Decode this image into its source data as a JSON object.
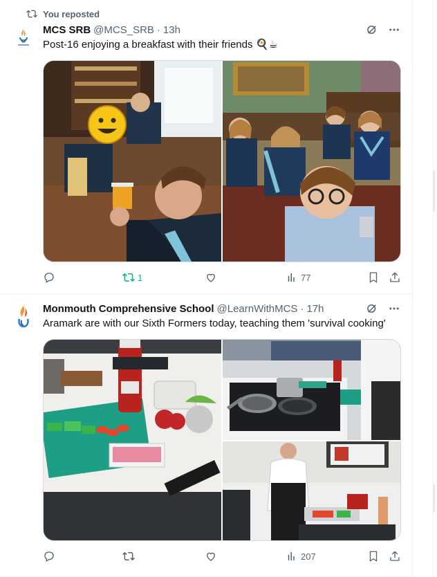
{
  "colors": {
    "muted": "#536471",
    "text": "#0f1419",
    "repost_green": "#00ba7c",
    "border": "#eff3f4"
  },
  "tweets": [
    {
      "reposted_label": "You reposted",
      "author_name": "MCS SRB",
      "handle": "@MCS_SRB",
      "separator": "·",
      "time": "13h",
      "text": "Post-16 enjoying a breakfast with their friends 🍳☕",
      "icons": [
        "grok-icon",
        "more-icon"
      ],
      "actions": {
        "replies": "",
        "reposts": "1",
        "likes": "",
        "views": "77"
      },
      "reposted_by_me": true
    },
    {
      "author_name": "Monmouth Comprehensive School",
      "handle": "@LearnWithMCS",
      "separator": "·",
      "time": "17h",
      "text": "Aramark are with our Sixth Formers today, teaching them 'survival cooking'",
      "icons": [
        "grok-icon",
        "more-icon"
      ],
      "actions": {
        "replies": "",
        "reposts": "",
        "likes": "",
        "views": "207"
      },
      "reposted_by_me": false
    }
  ]
}
